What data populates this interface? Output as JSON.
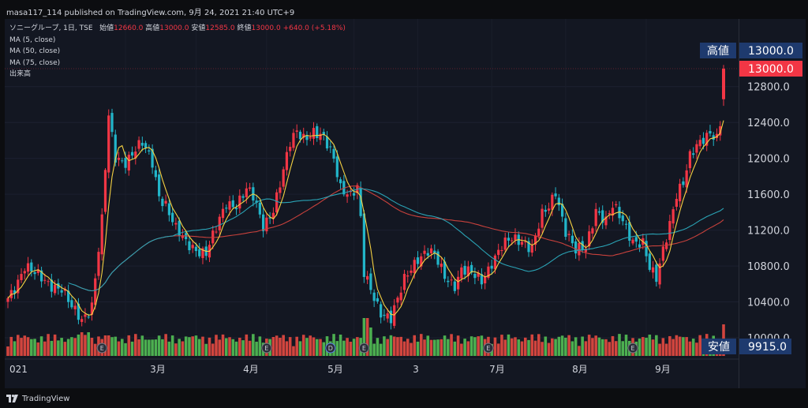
{
  "header": {
    "published": "masa117_114 published on TradingView.com, 9月 24, 2021 21:40 UTC+9"
  },
  "legend": {
    "symbol": "ソニーグループ, 1日, TSE",
    "open_label": "始値",
    "open_value": "12660.0",
    "high_label": "高値",
    "high_value": "13000.0",
    "low_label": "安値",
    "low_value": "12585.0",
    "close_label": "終値",
    "close_value": "13000.0",
    "change": "+640.0 (+5.18%)",
    "ma5": "MA (5, close)",
    "ma50": "MA (50, close)",
    "ma75": "MA (75, close)",
    "volume": "出来高"
  },
  "price_axis": {
    "ticks": [
      "12800.0",
      "12400.0",
      "12000.0",
      "11600.0",
      "11200.0",
      "10800.0",
      "10400.0",
      "10000.0"
    ],
    "high_tag_label": "高値",
    "high_tag_value": "13000.0",
    "last_price_value": "13000.0",
    "low_tag_label": "安値",
    "low_tag_value": "9915.0"
  },
  "time_axis": {
    "labels": [
      "021",
      "3月",
      "4月",
      "5月",
      "3",
      "7月",
      "8月",
      "9月"
    ]
  },
  "footer": {
    "brand": "TradingView"
  },
  "colors": {
    "up": "#f23645",
    "down": "#22b5c9",
    "vol_up": "#d2453e",
    "vol_down": "#4caf50",
    "ma5": "#f5d142",
    "ma50": "#2aa3b5",
    "ma75": "#c8413c",
    "tag_bg": "#1e3a6e",
    "last_bg": "#f23645"
  },
  "chart_data": {
    "type": "candlestick",
    "title": "ソニーグループ, 1日, TSE",
    "ylim": [
      9915,
      13000
    ],
    "x_ticks": [
      "021",
      "3月",
      "4月",
      "5月",
      "3",
      "7月",
      "8月",
      "9月"
    ],
    "last_bar": {
      "open": 12660.0,
      "high": 13000.0,
      "low": 12585.0,
      "close": 13000.0,
      "change": 640.0,
      "change_pct": 5.18
    },
    "range_high": 13000.0,
    "range_low": 9915.0,
    "close_anchors": [
      [
        0,
        10440
      ],
      [
        3,
        10650
      ],
      [
        5,
        10800
      ],
      [
        8,
        10700
      ],
      [
        12,
        10620
      ],
      [
        16,
        10550
      ],
      [
        19,
        10320
      ],
      [
        22,
        10200
      ],
      [
        25,
        10380
      ],
      [
        28,
        11300
      ],
      [
        30,
        12450
      ],
      [
        32,
        12000
      ],
      [
        35,
        11980
      ],
      [
        38,
        12100
      ],
      [
        40,
        12150
      ],
      [
        43,
        11950
      ],
      [
        45,
        11600
      ],
      [
        47,
        11500
      ],
      [
        50,
        11200
      ],
      [
        53,
        11050
      ],
      [
        56,
        11000
      ],
      [
        59,
        10950
      ],
      [
        62,
        11200
      ],
      [
        65,
        11500
      ],
      [
        68,
        11500
      ],
      [
        71,
        11650
      ],
      [
        73,
        11550
      ],
      [
        76,
        11250
      ],
      [
        79,
        11450
      ],
      [
        82,
        11850
      ],
      [
        84,
        12150
      ],
      [
        86,
        12300
      ],
      [
        88,
        12250
      ],
      [
        91,
        12300
      ],
      [
        94,
        12200
      ],
      [
        97,
        12000
      ],
      [
        99,
        11700
      ],
      [
        102,
        11600
      ],
      [
        104,
        11650
      ],
      [
        105,
        11300
      ],
      [
        106,
        10700
      ],
      [
        108,
        10550
      ],
      [
        111,
        10300
      ],
      [
        114,
        10200
      ],
      [
        116,
        10400
      ],
      [
        118,
        10650
      ],
      [
        120,
        10800
      ],
      [
        122,
        10900
      ],
      [
        125,
        10950
      ],
      [
        127,
        10900
      ],
      [
        130,
        10700
      ],
      [
        133,
        10600
      ],
      [
        135,
        10750
      ],
      [
        138,
        10700
      ],
      [
        141,
        10650
      ],
      [
        144,
        10850
      ],
      [
        147,
        11000
      ],
      [
        150,
        11100
      ],
      [
        153,
        11100
      ],
      [
        156,
        11000
      ],
      [
        159,
        11350
      ],
      [
        161,
        11450
      ],
      [
        163,
        11650
      ],
      [
        166,
        11200
      ],
      [
        169,
        10950
      ],
      [
        172,
        11000
      ],
      [
        175,
        11450
      ],
      [
        178,
        11300
      ],
      [
        180,
        11450
      ],
      [
        183,
        11300
      ],
      [
        186,
        11100
      ],
      [
        189,
        11050
      ],
      [
        191,
        10750
      ],
      [
        193,
        10650
      ],
      [
        195,
        11000
      ],
      [
        197,
        11300
      ],
      [
        199,
        11600
      ],
      [
        201,
        11700
      ],
      [
        203,
        12000
      ],
      [
        205,
        12150
      ],
      [
        207,
        12250
      ],
      [
        209,
        12300
      ],
      [
        211,
        12200
      ],
      [
        212,
        12360
      ],
      [
        213,
        13000
      ]
    ]
  }
}
